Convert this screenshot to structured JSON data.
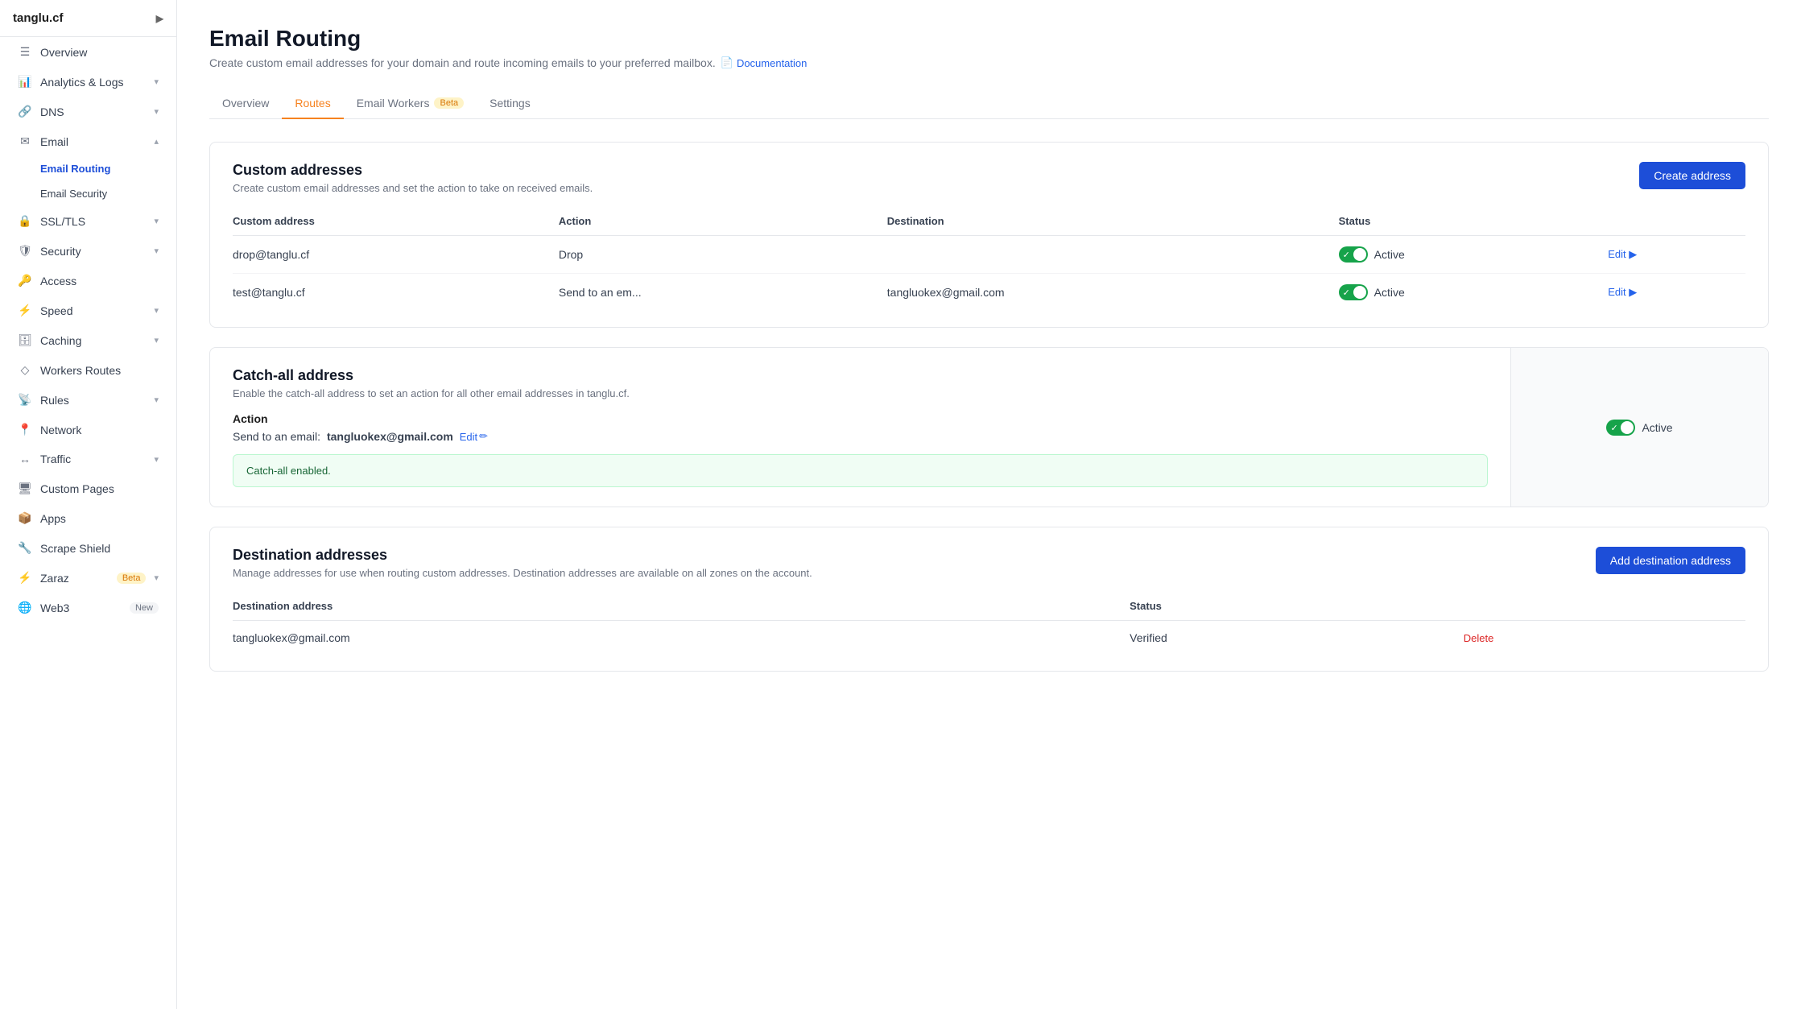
{
  "brand": {
    "name": "tanglu.cf",
    "arrow": "▶"
  },
  "sidebar": {
    "items": [
      {
        "id": "overview",
        "label": "Overview",
        "icon": "☰",
        "hasArrow": false,
        "active": false
      },
      {
        "id": "analytics",
        "label": "Analytics & Logs",
        "icon": "📊",
        "hasArrow": true,
        "active": false
      },
      {
        "id": "dns",
        "label": "DNS",
        "icon": "🔗",
        "hasArrow": true,
        "active": false
      },
      {
        "id": "email",
        "label": "Email",
        "icon": "✉",
        "hasArrow": true,
        "active": false,
        "expanded": true
      },
      {
        "id": "ssl",
        "label": "SSL/TLS",
        "icon": "🔒",
        "hasArrow": true,
        "active": false
      },
      {
        "id": "security",
        "label": "Security",
        "icon": "🛡",
        "hasArrow": true,
        "active": false
      },
      {
        "id": "access",
        "label": "Access",
        "icon": "🔑",
        "hasArrow": false,
        "active": false
      },
      {
        "id": "speed",
        "label": "Speed",
        "icon": "⚡",
        "hasArrow": true,
        "active": false
      },
      {
        "id": "caching",
        "label": "Caching",
        "icon": "🗄",
        "hasArrow": true,
        "active": false
      },
      {
        "id": "workers",
        "label": "Workers Routes",
        "icon": "◇",
        "hasArrow": false,
        "active": false
      },
      {
        "id": "rules",
        "label": "Rules",
        "icon": "📡",
        "hasArrow": true,
        "active": false
      },
      {
        "id": "network",
        "label": "Network",
        "icon": "📍",
        "hasArrow": false,
        "active": false
      },
      {
        "id": "traffic",
        "label": "Traffic",
        "icon": "↔",
        "hasArrow": true,
        "active": false
      },
      {
        "id": "custompages",
        "label": "Custom Pages",
        "icon": "🖥",
        "hasArrow": false,
        "active": false
      },
      {
        "id": "apps",
        "label": "Apps",
        "icon": "🖥",
        "hasArrow": false,
        "active": false
      },
      {
        "id": "scrape",
        "label": "Scrape Shield",
        "icon": "🔧",
        "hasArrow": false,
        "active": false
      },
      {
        "id": "zaraz",
        "label": "Zaraz",
        "icon": "⚡",
        "hasArrow": true,
        "active": false,
        "badge": "Beta",
        "badgeType": "orange"
      },
      {
        "id": "web3",
        "label": "Web3",
        "icon": "🌐",
        "hasArrow": false,
        "active": false,
        "badge": "New",
        "badgeType": "gray"
      }
    ],
    "emailSubItems": [
      {
        "id": "email-routing",
        "label": "Email Routing",
        "active": true
      },
      {
        "id": "email-security",
        "label": "Email Security",
        "active": false
      }
    ]
  },
  "page": {
    "title": "Email Routing",
    "subtitle": "Create custom email addresses for your domain and route incoming emails to your preferred mailbox.",
    "doc_link_text": "Documentation"
  },
  "tabs": [
    {
      "id": "overview",
      "label": "Overview",
      "active": false
    },
    {
      "id": "routes",
      "label": "Routes",
      "active": true
    },
    {
      "id": "email-workers",
      "label": "Email Workers",
      "active": false,
      "badge": "Beta"
    },
    {
      "id": "settings",
      "label": "Settings",
      "active": false
    }
  ],
  "custom_addresses": {
    "title": "Custom addresses",
    "description": "Create custom email addresses and set the action to take on received emails.",
    "create_button": "Create address",
    "columns": [
      "Custom address",
      "Action",
      "Destination",
      "Status"
    ],
    "rows": [
      {
        "address": "drop@tanglu.cf",
        "action": "Drop",
        "destination": "",
        "status": "Active",
        "enabled": true
      },
      {
        "address": "test@tanglu.cf",
        "action": "Send to an em...",
        "destination": "tangluokex@gmail.com",
        "status": "Active",
        "enabled": true
      }
    ],
    "edit_label": "Edit",
    "edit_arrow": "▶"
  },
  "catch_all": {
    "title": "Catch-all address",
    "description": "Enable the catch-all address to set an action for all other email addresses in tanglu.cf.",
    "action_label": "Action",
    "send_prefix": "Send to an email:",
    "email": "tangluokex@gmail.com",
    "edit_label": "Edit",
    "edit_icon": "✏",
    "status": "Active",
    "enabled": true,
    "banner_text": "Catch-all enabled."
  },
  "destination_addresses": {
    "title": "Destination addresses",
    "description": "Manage addresses for use when routing custom addresses. Destination addresses are available on all zones on the account.",
    "add_button": "Add destination address",
    "columns": [
      "Destination address",
      "Status"
    ],
    "rows": [
      {
        "address": "tangluokex@gmail.com",
        "status": "Verified"
      }
    ],
    "delete_label": "Delete"
  }
}
